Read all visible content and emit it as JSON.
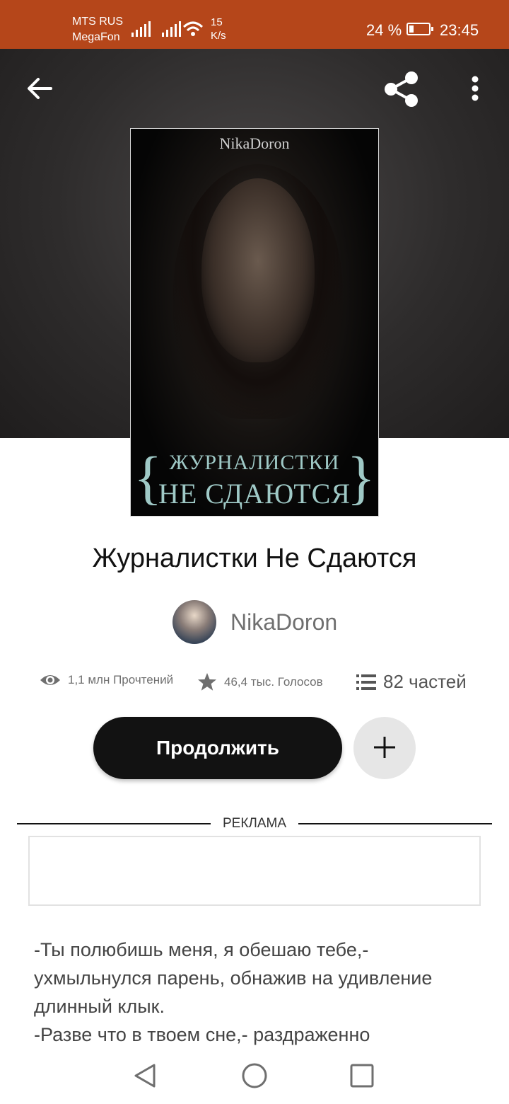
{
  "status_bar": {
    "carrier_1": "MTS RUS",
    "carrier_2": "MegaFon",
    "speed_value": "15",
    "speed_unit": "K/s",
    "battery": "24 %",
    "time": "23:45"
  },
  "cover": {
    "author": "NikaDoron",
    "title_line_1": "ЖУРНАЛИСТКИ",
    "title_line_2": "НЕ СДАЮТСЯ"
  },
  "book": {
    "title": "Журналистки Не Сдаются",
    "author": "NikaDoron"
  },
  "stats": {
    "reads": "1,1 млн Прочтений",
    "votes": "46,4 тыс. Голосов",
    "parts": "82 частей"
  },
  "actions": {
    "continue_label": "Продолжить"
  },
  "ad": {
    "label": "РЕКЛАМА"
  },
  "description": {
    "line_1": "-Ты полюбишь меня, я обешаю тебе,-",
    "line_2": "ухмыльнулся парень, обнажив на удивление",
    "line_3": "длинный клык.",
    "line_4": "-Разве что в твоем сне,- раздраженно"
  },
  "colors": {
    "status_bar": "#b5461a",
    "primary_button": "#121212",
    "secondary_button": "#e6e6e6",
    "cover_title": "#9fc9c6"
  }
}
